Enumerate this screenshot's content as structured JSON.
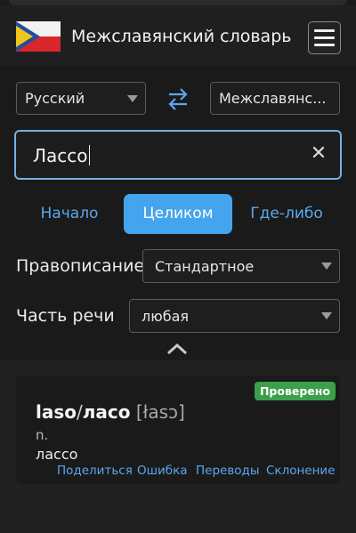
{
  "header": {
    "title": "Межславянский словарь",
    "flag_icon": "interslavic-flag-icon",
    "menu_icon": "hamburger-menu-icon"
  },
  "languages": {
    "source": "Русский",
    "target": "Межславянс...",
    "swap_icon": "swap-arrows-icon",
    "accent": "#5aa8ee"
  },
  "search": {
    "value": "Лассо",
    "clear_icon": "close-icon",
    "focus_border": "#78aee6"
  },
  "modes": {
    "items": [
      "Начало",
      "Целиком",
      "Где-либо"
    ],
    "active": "Целиком",
    "active_color": "#45a4ee"
  },
  "filters": {
    "spelling_label": "Правописание",
    "spelling_value": "Стандартное",
    "pos_label": "Часть речи",
    "pos_value": "любая",
    "collapse_icon": "chevron-up-icon"
  },
  "result": {
    "badge": "Проверено",
    "badge_color": "#3c9f4a",
    "latin": "laso",
    "slash": "/",
    "cyrillic": "ласо",
    "ipa": "[łasɔ]",
    "pos": "n.",
    "translation": "лассо",
    "actions": [
      "Поделиться",
      "Ошибка",
      "Переводы",
      "Склонение"
    ]
  }
}
